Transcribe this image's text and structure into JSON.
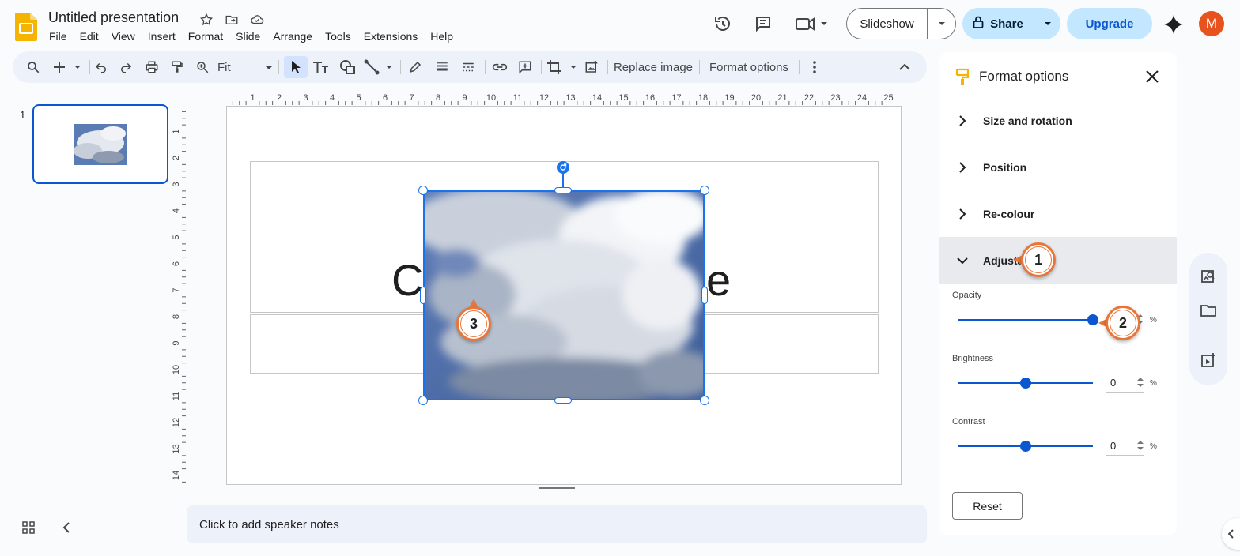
{
  "app": {
    "title": "Untitled presentation",
    "menu": [
      "File",
      "Edit",
      "View",
      "Insert",
      "Format",
      "Slide",
      "Arrange",
      "Tools",
      "Extensions",
      "Help"
    ],
    "slideshow_label": "Slideshow",
    "share_label": "Share",
    "upgrade_label": "Upgrade",
    "avatar_initial": "M",
    "accent": "#0b57d0",
    "avatar_color": "#e8521d"
  },
  "toolbar": {
    "zoom_value": "Fit",
    "replace_image_label": "Replace image",
    "format_options_label": "Format options"
  },
  "filmstrip": {
    "slide_number": "1"
  },
  "ruler": {
    "top_ticks": [
      "1",
      "2",
      "3",
      "4",
      "5",
      "6",
      "7",
      "8",
      "9",
      "10",
      "11",
      "12",
      "13",
      "14",
      "15",
      "16",
      "17",
      "18",
      "19",
      "20",
      "21",
      "22",
      "23",
      "24",
      "25"
    ],
    "left_ticks": [
      "1",
      "2",
      "3",
      "4",
      "5",
      "6",
      "7",
      "8",
      "9",
      "10",
      "11",
      "12",
      "13",
      "14"
    ]
  },
  "slide": {
    "title_left": "C",
    "title_right": "e"
  },
  "notes": {
    "placeholder": "Click to add speaker notes"
  },
  "panel": {
    "title": "Format options",
    "sections": [
      {
        "label": "Size and rotation",
        "expanded": false
      },
      {
        "label": "Position",
        "expanded": false
      },
      {
        "label": "Re-colour",
        "expanded": false
      },
      {
        "label": "Adjusta",
        "expanded": true
      }
    ],
    "adjustments": {
      "opacity_label": "Opacity",
      "opacity_level": 1.0,
      "opacity_unit": "%",
      "brightness_label": "Brightness",
      "brightness_value": "0",
      "brightness_unit": "%",
      "brightness_level": 0.5,
      "contrast_label": "Contrast",
      "contrast_value": "0",
      "contrast_unit": "%",
      "contrast_level": 0.5
    },
    "reset_label": "Reset"
  },
  "steps": [
    "1",
    "2",
    "3"
  ]
}
